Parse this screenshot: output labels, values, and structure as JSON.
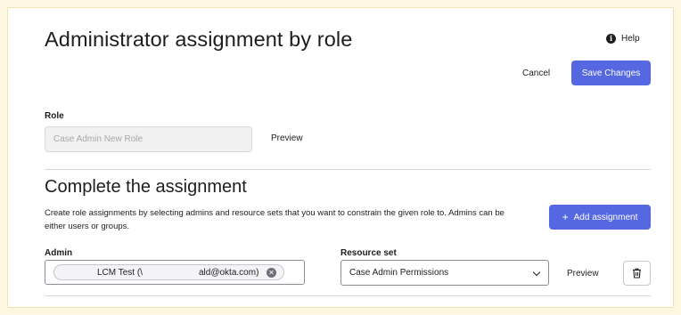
{
  "header": {
    "title": "Administrator assignment by role",
    "help_label": "Help",
    "cancel_label": "Cancel",
    "save_label": "Save Changes"
  },
  "role": {
    "label": "Role",
    "placeholder": "Case Admin New Role",
    "preview_label": "Preview"
  },
  "assignment": {
    "heading": "Complete the assignment",
    "description": "Create role assignments by selecting admins and resource sets that you want to constrain the given role to. Admins can be either users or groups.",
    "add_label": "Add assignment",
    "rows": [
      {
        "admin_label": "Admin",
        "admin_chip_name": "LCM Test (\\",
        "admin_chip_email": "ald@okta.com)",
        "resource_label": "Resource set",
        "resource_value": "Case Admin Permissions",
        "preview_label": "Preview"
      }
    ]
  },
  "icons": {
    "help": "info-icon",
    "add": "plus-icon",
    "chip_remove": "close-circle-icon",
    "select": "chevron-down-icon",
    "delete": "trash-icon"
  },
  "colors": {
    "accent": "#5567e1",
    "page_background": "#fdf6e0"
  }
}
